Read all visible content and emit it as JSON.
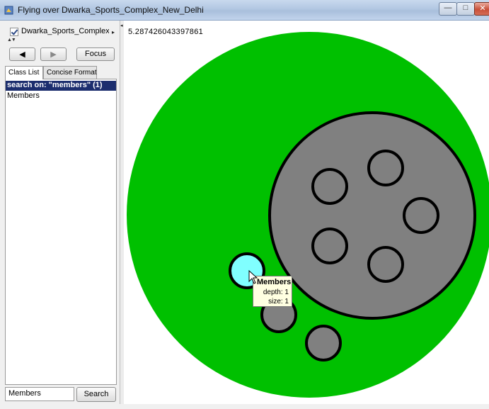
{
  "window": {
    "title": "Flying over Dwarka_Sports_Complex_New_Delhi",
    "minimize_glyph": "—",
    "maximize_glyph": "□",
    "close_glyph": "✕"
  },
  "sidebar": {
    "dataset_checkbox": {
      "label": "Dwarka_Sports_Complex_N",
      "checked": true
    },
    "back_glyph": "◀",
    "forward_glyph": "▶",
    "focus_label": "Focus",
    "tabs": [
      {
        "label": "Class List",
        "active": true
      },
      {
        "label": "Concise Format",
        "active": false
      }
    ],
    "results_header": "search on: \"members\" (1)",
    "results": [
      "Members"
    ],
    "search_value": "Members",
    "search_button": "Search"
  },
  "viewer": {
    "zoom_readout": "5.287426043397861",
    "tooltip": {
      "title": "Members",
      "depth": "depth: 1",
      "size": "size: 1"
    }
  },
  "colors": {
    "root_circle": "#00c000",
    "child_circle": "#808080",
    "highlight_circle": "#80ffff",
    "outline": "#000000",
    "selection_header": "#1c2e6e"
  },
  "icons": [
    "app-icon",
    "checkbox-icon",
    "back-arrow-icon",
    "forward-arrow-icon",
    "mouse-cursor-icon"
  ]
}
